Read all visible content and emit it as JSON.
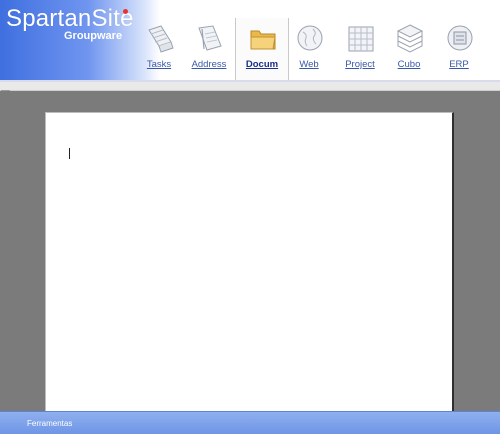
{
  "app": {
    "title": "SpartanSite",
    "subtitle": "Groupware"
  },
  "nav": {
    "items": [
      {
        "label": "Tasks",
        "icon": "tasks-icon"
      },
      {
        "label": "Address",
        "icon": "address-book-icon"
      },
      {
        "label": "Docum",
        "icon": "folder-icon",
        "active": true
      },
      {
        "label": "Web",
        "icon": "globe-icon"
      },
      {
        "label": "Project",
        "icon": "project-grid-icon"
      },
      {
        "label": "Cubo",
        "icon": "cube-layers-icon"
      },
      {
        "label": "ERP",
        "icon": "erp-globe-icon"
      }
    ]
  },
  "statusbar": {
    "label": "Ferramentas"
  },
  "colors": {
    "brand_gradient_start": "#3f6fe0",
    "nav_text": "#3a58a8",
    "statusbar": "#7a9ee9",
    "workspace": "#7b7b7b"
  }
}
